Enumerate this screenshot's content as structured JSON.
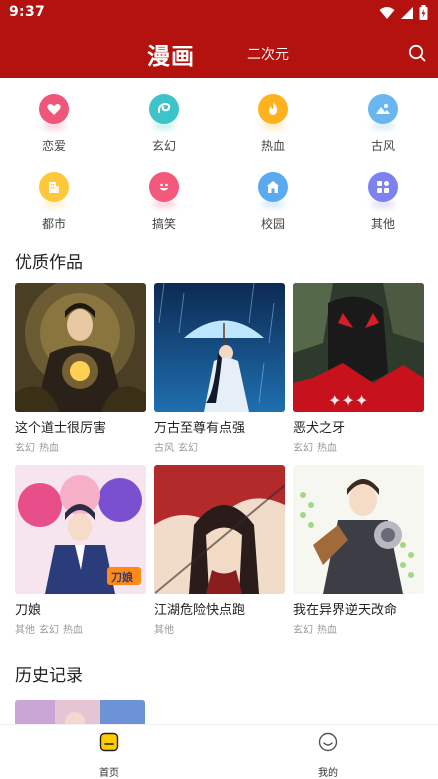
{
  "status_bar": {
    "time": "9:37",
    "icons": [
      "wifi-icon",
      "signal-icon",
      "battery-icon"
    ]
  },
  "app_bar": {
    "tab_active": "漫画",
    "tab_other": "二次元",
    "search_icon": "search-icon"
  },
  "theme": {
    "primary": "#b3120f",
    "nav_active": "#ffcc00"
  },
  "categories": [
    {
      "label": "恋爱",
      "icon": "heart-icon",
      "color": "#f0567a"
    },
    {
      "label": "玄幻",
      "icon": "swirl-icon",
      "color": "#3cc4c8"
    },
    {
      "label": "热血",
      "icon": "flame-icon",
      "color": "#ffb21e"
    },
    {
      "label": "古风",
      "icon": "landscape-icon",
      "color": "#6ab6f0"
    },
    {
      "label": "都市",
      "icon": "building-icon",
      "color": "#ffc83a"
    },
    {
      "label": "搞笑",
      "icon": "smile-icon",
      "color": "#f4587a"
    },
    {
      "label": "校园",
      "icon": "school-icon",
      "color": "#5aaaf0"
    },
    {
      "label": "其他",
      "icon": "grid-icon",
      "color": "#7e82f0"
    }
  ],
  "featured": {
    "title": "优质作品",
    "items": [
      {
        "title": "这个道士很厉害",
        "tags": [
          "玄幻",
          "热血"
        ]
      },
      {
        "title": "万古至尊有点强",
        "tags": [
          "古风",
          "玄幻"
        ]
      },
      {
        "title": "恶犬之牙",
        "tags": [
          "玄幻",
          "热血"
        ]
      },
      {
        "title": "刀娘",
        "tags": [
          "其他",
          "玄幻",
          "热血"
        ]
      },
      {
        "title": "江湖危险快点跑",
        "tags": [
          "其他"
        ]
      },
      {
        "title": "我在异界逆天改命",
        "tags": [
          "玄幻",
          "热血"
        ]
      }
    ]
  },
  "history": {
    "title": "历史记录"
  },
  "bottom_nav": [
    {
      "label": "首页",
      "icon": "home-icon",
      "active": true
    },
    {
      "label": "我的",
      "icon": "profile-icon",
      "active": false
    }
  ]
}
